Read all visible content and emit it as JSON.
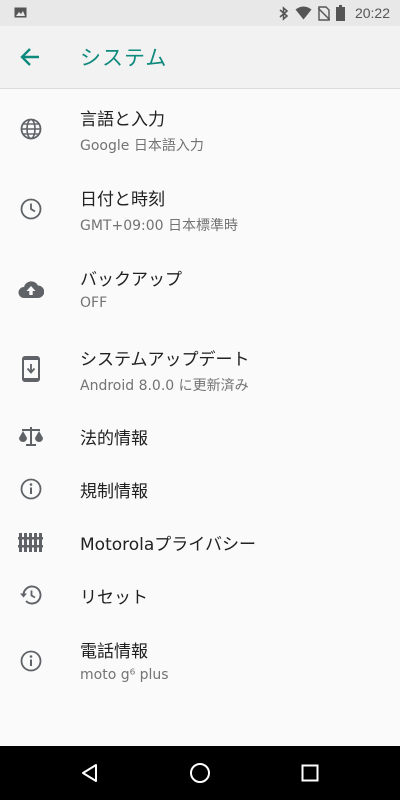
{
  "status_bar": {
    "time": "20:22",
    "icons": [
      "gallery-icon",
      "bluetooth-icon",
      "wifi-icon",
      "no-sim-icon",
      "battery-icon"
    ]
  },
  "app_bar": {
    "title": "システム",
    "back_icon": "arrow-left-icon",
    "accent_color": "#0f8a7d"
  },
  "settings": [
    {
      "icon": "globe-icon",
      "title": "言語と入力",
      "subtitle": "Google 日本語入力"
    },
    {
      "icon": "clock-icon",
      "title": "日付と時刻",
      "subtitle": "GMT+09:00 日本標準時"
    },
    {
      "icon": "cloud-upload-icon",
      "title": "バックアップ",
      "subtitle": "OFF"
    },
    {
      "icon": "system-update-icon",
      "title": "システムアップデート",
      "subtitle": "Android 8.0.0 に更新済み"
    },
    {
      "icon": "scale-icon",
      "title": "法的情報"
    },
    {
      "icon": "info-icon",
      "title": "規制情報"
    },
    {
      "icon": "fence-icon",
      "title": "Motorolaプライバシー"
    },
    {
      "icon": "history-icon",
      "title": "リセット"
    },
    {
      "icon": "info-icon",
      "title": "電話情報",
      "subtitle": "moto g⁶ plus"
    }
  ],
  "nav_bar": {
    "icons": [
      "back-triangle-icon",
      "home-circle-icon",
      "recents-square-icon"
    ]
  }
}
